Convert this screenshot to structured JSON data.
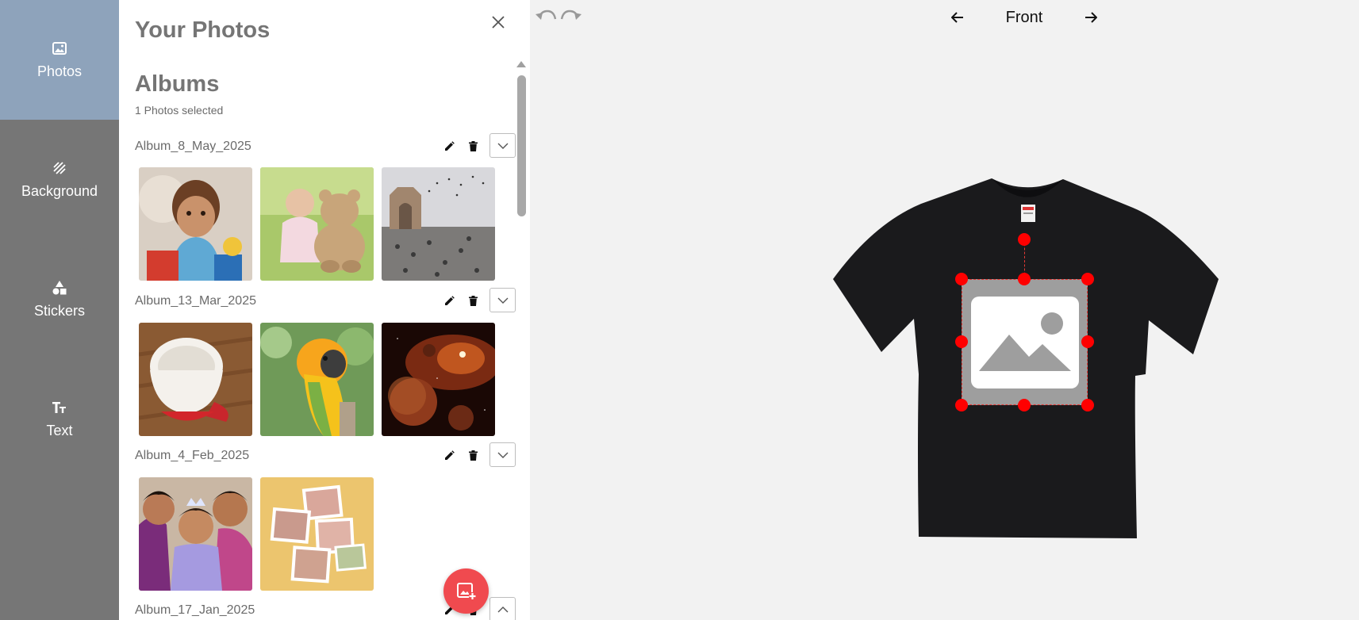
{
  "rail": {
    "items": [
      {
        "label": "Photos",
        "icon": "image-icon",
        "active": true
      },
      {
        "label": "Background",
        "icon": "background-pattern-icon",
        "active": false
      },
      {
        "label": "Stickers",
        "icon": "shapes-icon",
        "active": false
      },
      {
        "label": "Text",
        "icon": "text-size-icon",
        "active": false
      }
    ]
  },
  "panel": {
    "title": "Your Photos",
    "albums_title": "Albums",
    "selected_count": "1 Photos selected",
    "albums": [
      {
        "name": "Album_8_May_2025",
        "expanded": true,
        "photos": [
          "baby with toys",
          "baby with teddy bear",
          "gateway with birds"
        ]
      },
      {
        "name": "Album_13_Mar_2025",
        "expanded": true,
        "photos": [
          "red cup",
          "parrot",
          "space planets"
        ]
      },
      {
        "name": "Album_4_Feb_2025",
        "expanded": true,
        "photos": [
          "family portrait",
          "photo collage"
        ]
      },
      {
        "name": "Album_17_Jan_2025",
        "expanded": false,
        "photos": []
      }
    ]
  },
  "canvas": {
    "side_label": "Front",
    "colors": {
      "accent": "#f04a4f",
      "handle": "#ff0000",
      "rail": "#767676",
      "rail_active": "#8ea3bb",
      "shirt": "#1a1a1c"
    }
  }
}
